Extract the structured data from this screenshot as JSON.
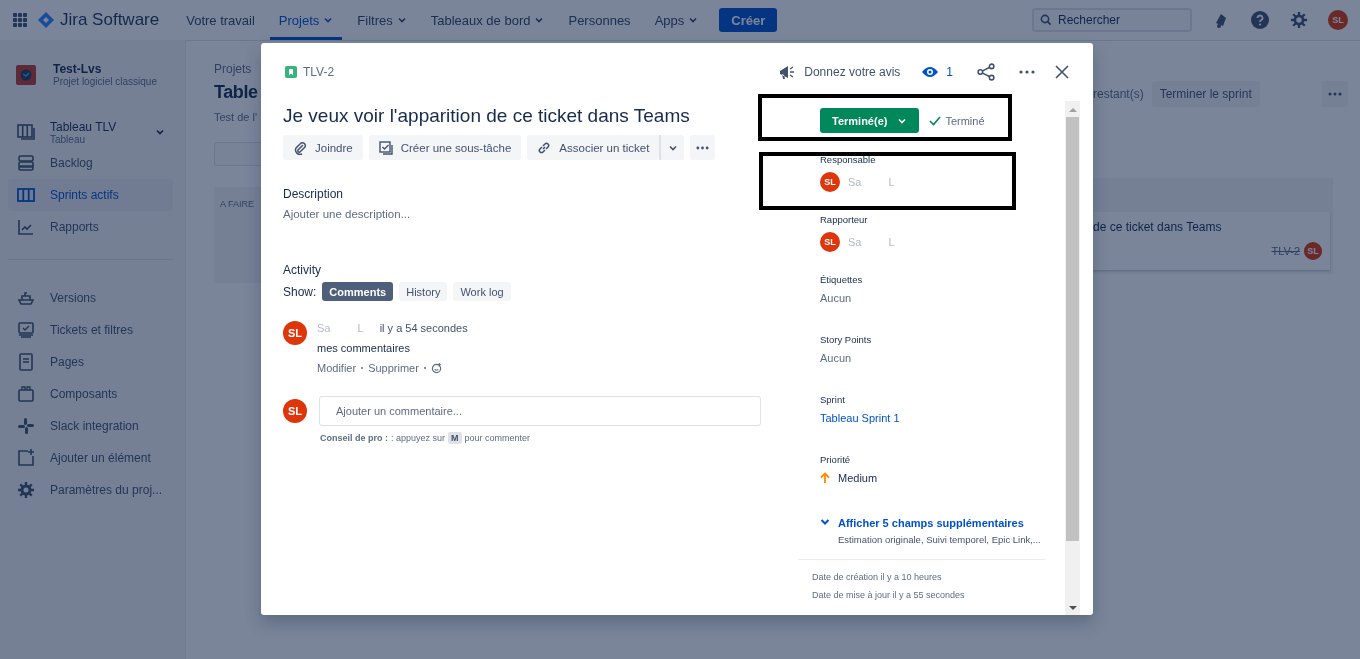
{
  "nav": {
    "product": "Jira Software",
    "items": [
      {
        "label": "Votre travail",
        "dropdown": false,
        "selected": false
      },
      {
        "label": "Projets",
        "dropdown": true,
        "selected": true
      },
      {
        "label": "Filtres",
        "dropdown": true,
        "selected": false
      },
      {
        "label": "Tableaux de bord",
        "dropdown": true,
        "selected": false
      },
      {
        "label": "Personnes",
        "dropdown": false,
        "selected": false
      },
      {
        "label": "Apps",
        "dropdown": true,
        "selected": false
      }
    ],
    "create": "Créer",
    "search_placeholder": "Rechercher",
    "avatar": "SL"
  },
  "sidebar": {
    "project": {
      "name": "Test-Lvs",
      "type": "Projet logiciel classique"
    },
    "board": {
      "name": "Tableau TLV",
      "type": "Tableau"
    },
    "groups": [
      [
        {
          "label": "Backlog",
          "selected": false
        },
        {
          "label": "Sprints actifs",
          "selected": true
        },
        {
          "label": "Rapports",
          "selected": false
        }
      ],
      [
        {
          "label": "Versions",
          "selected": false
        },
        {
          "label": "Tickets et filtres",
          "selected": false
        },
        {
          "label": "Pages",
          "selected": false
        },
        {
          "label": "Composants",
          "selected": false
        },
        {
          "label": "Slack integration",
          "selected": false
        },
        {
          "label": "Ajouter un élément",
          "selected": false
        },
        {
          "label": "Paramètres du proj...",
          "selected": false
        }
      ]
    ]
  },
  "board_page": {
    "breadcrumb": "Projets",
    "title": "Table",
    "subtitle": "Test de l'",
    "column": "A FAIRE",
    "remaining": "restant(s)",
    "complete_button": "Terminer le sprint",
    "card": {
      "summary": "de ce ticket dans Teams",
      "key": "TLV-2",
      "done": true,
      "avatar": "SL"
    }
  },
  "issue": {
    "key": "TLV-2",
    "feedback": "Donnez votre avis",
    "watchers": "1",
    "summary": "Je veux voir l'apparition de ce ticket dans Teams",
    "actions": [
      "Joindre",
      "Créer une sous-tâche",
      "Associer un ticket"
    ],
    "description": {
      "label": "Description",
      "prompt": "Ajouter une description..."
    },
    "activity": {
      "label": "Activity",
      "show_label": "Show:",
      "filters": [
        {
          "label": "Comments",
          "selected": true
        },
        {
          "label": "History",
          "selected": false
        },
        {
          "label": "Work log",
          "selected": false
        }
      ],
      "comments": [
        {
          "avatar": "SL",
          "author": "Sa L",
          "time": "il y a 54 secondes",
          "body": "mes commentaires",
          "actions": [
            "Modifier",
            "Supprimer"
          ]
        }
      ],
      "new_comment": {
        "avatar": "SL",
        "placeholder": "Ajouter un commentaire..."
      },
      "tip": {
        "label": "Conseil de pro :",
        "before": ": appuyez sur",
        "key": "M",
        "after": "pour commenter"
      }
    },
    "status": {
      "label": "Terminé(e)",
      "resolution": "Terminé"
    },
    "fields": [
      {
        "kind": "user",
        "label": "Responsable",
        "avatar": "SL",
        "value": "Sa L"
      },
      {
        "kind": "user",
        "label": "Rapporteur",
        "avatar": "SL",
        "value": "Sa L"
      },
      {
        "kind": "empty",
        "label": "Étiquettes",
        "value": "Aucun"
      },
      {
        "kind": "empty",
        "label": "Story Points",
        "value": "Aucun"
      },
      {
        "kind": "link",
        "label": "Sprint",
        "value": "Tableau Sprint 1"
      },
      {
        "kind": "priority",
        "label": "Priorité",
        "value": "Medium"
      }
    ],
    "more_fields": {
      "label": "Afficher 5 champs supplémentaires",
      "hint": "Estimation originale, Suivi temporel, Epic Link,..."
    },
    "dates": [
      "Date de création il y a 10 heures",
      "Date de mise à jour il y a 55 secondes"
    ]
  }
}
